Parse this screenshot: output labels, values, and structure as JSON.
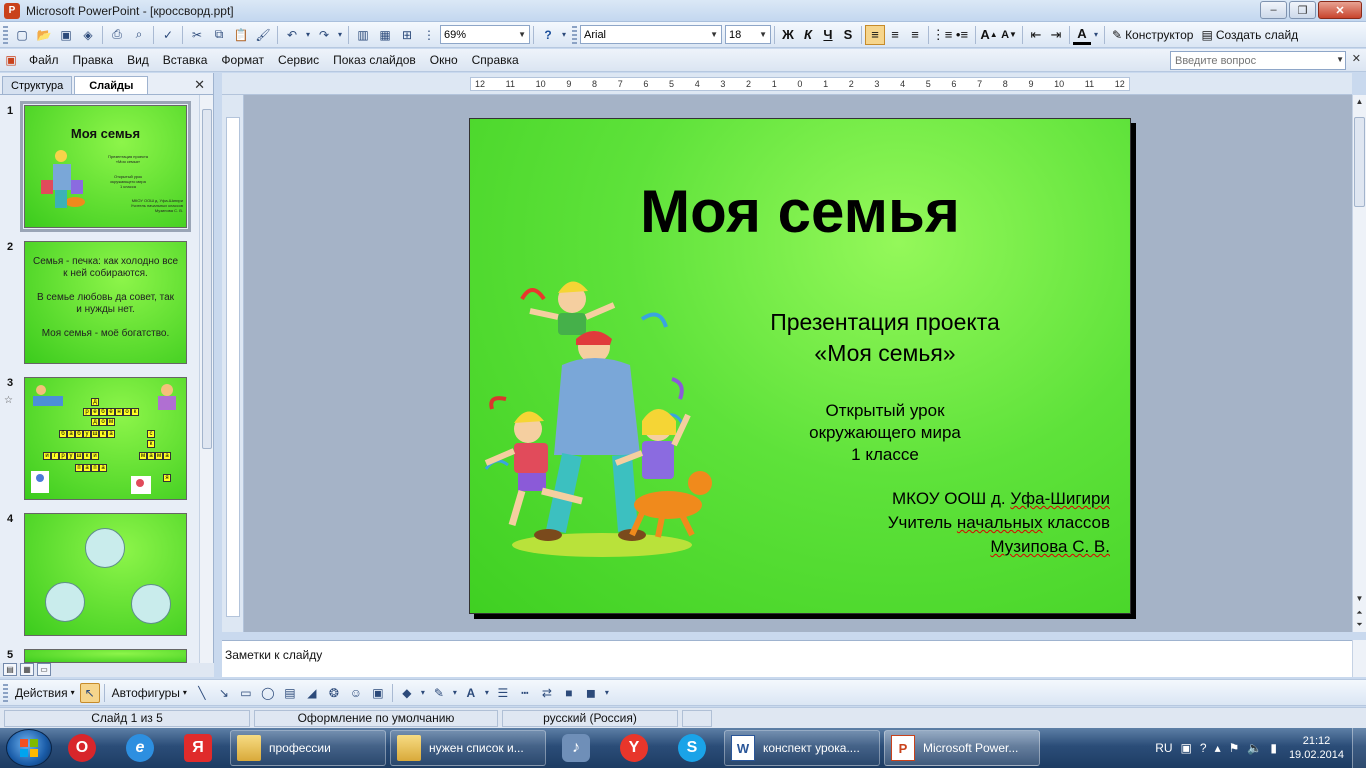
{
  "window": {
    "title": "Microsoft PowerPoint - [кроссворд.ppt]",
    "app_icon": "P",
    "minimize": "–",
    "maximize": "❐",
    "close": "✕"
  },
  "toolbar": {
    "zoom": "69%",
    "font_name": "Arial",
    "font_size": "18",
    "designer_label": "Конструктор",
    "new_slide_label": "Создать слайд",
    "bold": "Ж",
    "italic": "К",
    "underline": "Ч",
    "shadow": "S",
    "font_color_label": "A"
  },
  "menu": {
    "items": [
      "Файл",
      "Правка",
      "Вид",
      "Вставка",
      "Формат",
      "Сервис",
      "Показ слайдов",
      "Окно",
      "Справка"
    ],
    "help_placeholder": "Введите вопрос"
  },
  "left_pane": {
    "tabs": [
      "Структура",
      "Слайды"
    ],
    "close": "✕",
    "slides": [
      {
        "number": "1",
        "title": "Моя семья",
        "lines": [
          "Презентация проекта",
          "«Моя семья»",
          "Открытый урок",
          "окружающего мира",
          "1 класса",
          "МКОУ ООШ д. Уфа-Шигири",
          "Учитель начальных классов",
          "Музипова С. В."
        ]
      },
      {
        "number": "2",
        "text": "Семья - печка: как холодно все\nк ней собираются.\n\nВ семье любовь да совет, так\nи нужды нет.\n\nМоя семья - моё богатство."
      },
      {
        "number": "3",
        "star": "☆",
        "crossword": {
          "row1": [
            "р",
            "е",
            "б",
            "ё",
            "н",
            "о",
            "к"
          ],
          "top": "д",
          "row2": [
            "д",
            "о",
            "м"
          ],
          "row3": [
            "б",
            "а",
            "б",
            "у",
            "ш",
            "к",
            "а"
          ],
          "row4": [
            "и",
            "г",
            "р",
            "у",
            "ш",
            "к",
            "и"
          ],
          "row5": [
            "п",
            "а",
            "п",
            "а"
          ],
          "right": [
            "с",
            "к",
            "м",
            "а",
            "м",
            "а",
            "я"
          ]
        }
      },
      {
        "number": "4"
      },
      {
        "number": "5"
      }
    ]
  },
  "ruler": {
    "labels": [
      "12",
      "11",
      "10",
      "9",
      "8",
      "7",
      "6",
      "5",
      "4",
      "3",
      "2",
      "1",
      "0",
      "1",
      "2",
      "3",
      "4",
      "5",
      "6",
      "7",
      "8",
      "9",
      "10",
      "11",
      "12"
    ]
  },
  "slide": {
    "title": "Моя семья",
    "subtitle_1": "Презентация проекта",
    "subtitle_2": "«Моя семья»",
    "lesson_1": "Открытый урок",
    "lesson_2": "окружающего мира",
    "lesson_3": "1 классе",
    "school_prefix": "МКОУ ООШ д.",
    "school_name": "Уфа-Шигири",
    "teacher_1": "Учитель",
    "teacher_2": "начальных",
    "teacher_3": "классов",
    "author": "Музипова С. В."
  },
  "notes": {
    "placeholder": "Заметки к слайду"
  },
  "drawbar": {
    "actions_label": "Действия",
    "autoshapes_label": "Автофигуры"
  },
  "status": {
    "slide": "Слайд 1 из 5",
    "design": "Оформление по умолчанию",
    "language": "русский (Россия)"
  },
  "taskbar": {
    "tasks": [
      {
        "label": "профессии",
        "icon": "folder-icon"
      },
      {
        "label": "нужен список и...",
        "icon": "folder-icon"
      },
      {
        "label": "конспект урока....",
        "icon": "word-icon"
      },
      {
        "label": "Microsoft Power...",
        "icon": "powerpoint-icon"
      }
    ],
    "lang": "RU",
    "time": "21:12",
    "date": "19.02.2014",
    "word_letter": "W",
    "ppt_letter": "P",
    "opera_letter": "O",
    "ie_letter": "e",
    "yandex_letter": "Я",
    "yandex2_letter": "Y",
    "skype_letter": "S"
  }
}
